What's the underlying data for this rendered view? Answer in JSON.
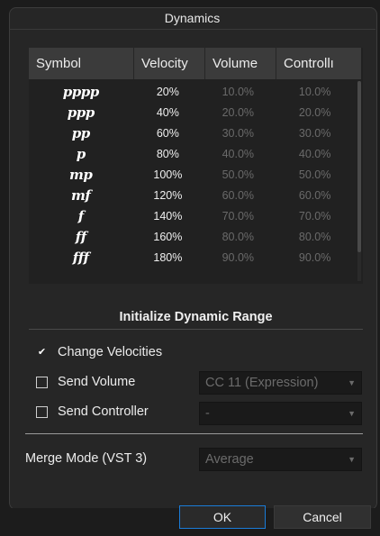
{
  "window": {
    "title": "Dynamics"
  },
  "table": {
    "columns": [
      "Symbol",
      "Velocity",
      "Volume",
      "Controllı"
    ],
    "rows": [
      {
        "symbol": "pppp",
        "velocity": "20%",
        "volume": "10.0%",
        "controller": "10.0%"
      },
      {
        "symbol": "ppp",
        "velocity": "40%",
        "volume": "20.0%",
        "controller": "20.0%"
      },
      {
        "symbol": "pp",
        "velocity": "60%",
        "volume": "30.0%",
        "controller": "30.0%"
      },
      {
        "symbol": "p",
        "velocity": "80%",
        "volume": "40.0%",
        "controller": "40.0%"
      },
      {
        "symbol": "mp",
        "velocity": "100%",
        "volume": "50.0%",
        "controller": "50.0%"
      },
      {
        "symbol": "mf",
        "velocity": "120%",
        "volume": "60.0%",
        "controller": "60.0%"
      },
      {
        "symbol": "f",
        "velocity": "140%",
        "volume": "70.0%",
        "controller": "70.0%"
      },
      {
        "symbol": "ff",
        "velocity": "160%",
        "volume": "80.0%",
        "controller": "80.0%"
      },
      {
        "symbol": "fff",
        "velocity": "180%",
        "volume": "90.0%",
        "controller": "90.0%"
      }
    ]
  },
  "range": {
    "title": "Initialize Dynamic Range",
    "change_velocities": {
      "label": "Change Velocities",
      "checked": true
    },
    "send_volume": {
      "label": "Send Volume",
      "checked": false,
      "value": "CC 11 (Expression)"
    },
    "send_controller": {
      "label": "Send Controller",
      "checked": false,
      "value": "-"
    }
  },
  "merge": {
    "label": "Merge Mode (VST 3)",
    "value": "Average"
  },
  "buttons": {
    "ok": "OK",
    "cancel": "Cancel"
  },
  "icons": {
    "check": "checkmark-icon",
    "caret": "chevron-down-icon"
  },
  "colors": {
    "accent": "#1a7cd8",
    "background": "#262626",
    "header": "#3b3b3b"
  }
}
